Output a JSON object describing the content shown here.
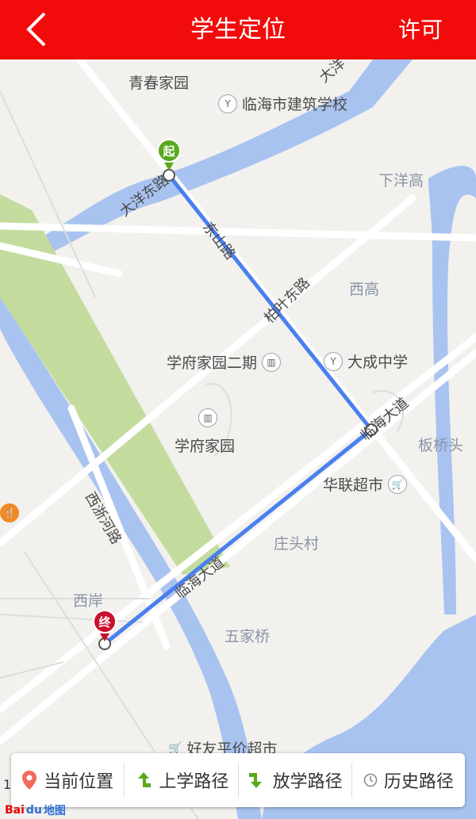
{
  "header": {
    "title": "学生定位",
    "right_action": "许可",
    "back_icon": "chevron-left-icon"
  },
  "map": {
    "labels": {
      "qingchun": "青春家园",
      "jianzhu": "临海市建筑学校",
      "dayang_road": "大洋东路",
      "xiayanggao": "下洋高",
      "dongshan_road": "东山路",
      "baiye_road": "柏叶东路",
      "xigao": "西高",
      "xuefu2": "学府家园二期",
      "dacheng": "大成中学",
      "linhai_avenue_1": "临海大道",
      "xuefu": "学府家园",
      "banqiaotou": "板桥头",
      "hualian": "华联超市",
      "xizhehe_road": "西浙河路",
      "zhuangtou": "庄头村",
      "linhai_avenue_2": "临海大道",
      "xian": "西岸",
      "wujiaqiao": "五家桥",
      "haoyou": "好友平价超市",
      "top_road": "大洋"
    },
    "start_marker": "起",
    "end_marker": "终",
    "route_color": "#4a7ff0"
  },
  "bottom_bar": {
    "tabs": [
      {
        "label": "当前位置",
        "icon": "location-pin-icon"
      },
      {
        "label": "上学路径",
        "icon": "turn-up-right-arrow-icon"
      },
      {
        "label": "放学路径",
        "icon": "turn-down-left-arrow-icon"
      },
      {
        "label": "历史路径",
        "icon": "clock-icon"
      }
    ]
  },
  "logo": {
    "brand": "Bai",
    "brand2": "du",
    "text": "地图"
  },
  "scale_digit": "1",
  "colors": {
    "header": "#f20b0b",
    "water": "#a9c3f0",
    "park": "#c3dc9e",
    "start_pin": "#5aa81e",
    "end_pin": "#c8102e"
  }
}
